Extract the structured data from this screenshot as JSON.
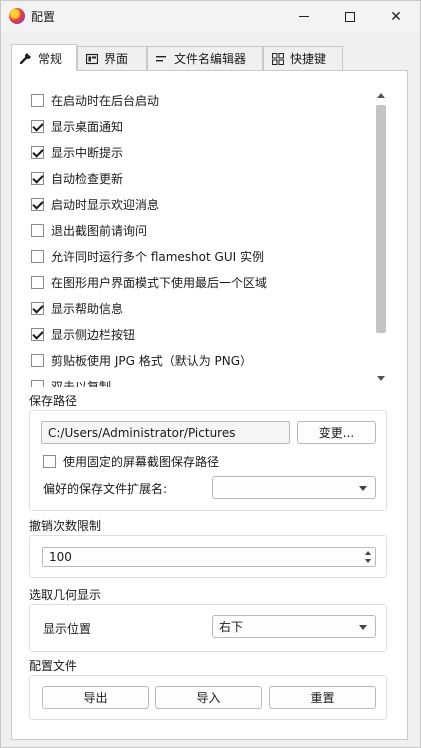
{
  "window": {
    "title": "配置"
  },
  "tabs": [
    {
      "label": "常规",
      "icon": "wrench-icon",
      "active": true
    },
    {
      "label": "界面",
      "icon": "layout-icon",
      "active": false
    },
    {
      "label": "文件名编辑器",
      "icon": "text-lines-icon",
      "active": false
    },
    {
      "label": "快捷键",
      "icon": "grid-icon",
      "active": false
    }
  ],
  "general": {
    "options": [
      {
        "label": "在启动时在后台启动",
        "checked": false
      },
      {
        "label": "显示桌面通知",
        "checked": true
      },
      {
        "label": "显示中断提示",
        "checked": true
      },
      {
        "label": "自动检查更新",
        "checked": true
      },
      {
        "label": "启动时显示欢迎消息",
        "checked": true
      },
      {
        "label": "退出截图前请询问",
        "checked": false
      },
      {
        "label": "允许同时运行多个 flameshot GUI 实例",
        "checked": false
      },
      {
        "label": "在图形用户界面模式下使用最后一个区域",
        "checked": false
      },
      {
        "label": "显示帮助信息",
        "checked": true
      },
      {
        "label": "显示侧边栏按钮",
        "checked": true
      },
      {
        "label": "剪贴板使用 JPG 格式（默认为 PNG）",
        "checked": false
      },
      {
        "label": "双击以复制",
        "checked": false
      }
    ]
  },
  "save_path": {
    "title": "保存路径",
    "path_value": "C:/Users/Administrator/Pictures",
    "change_button": "变更...",
    "fixed_path_label": "使用固定的屏幕截图保存路径",
    "fixed_path_checked": false,
    "extension_label": "偏好的保存文件扩展名:",
    "extension_value": ""
  },
  "undo": {
    "title": "撤销次数限制",
    "value": "100"
  },
  "geometry": {
    "title": "选取几何显示",
    "position_label": "显示位置",
    "position_value": "右下"
  },
  "config_file": {
    "title": "配置文件",
    "export_label": "导出",
    "import_label": "导入",
    "reset_label": "重置"
  }
}
